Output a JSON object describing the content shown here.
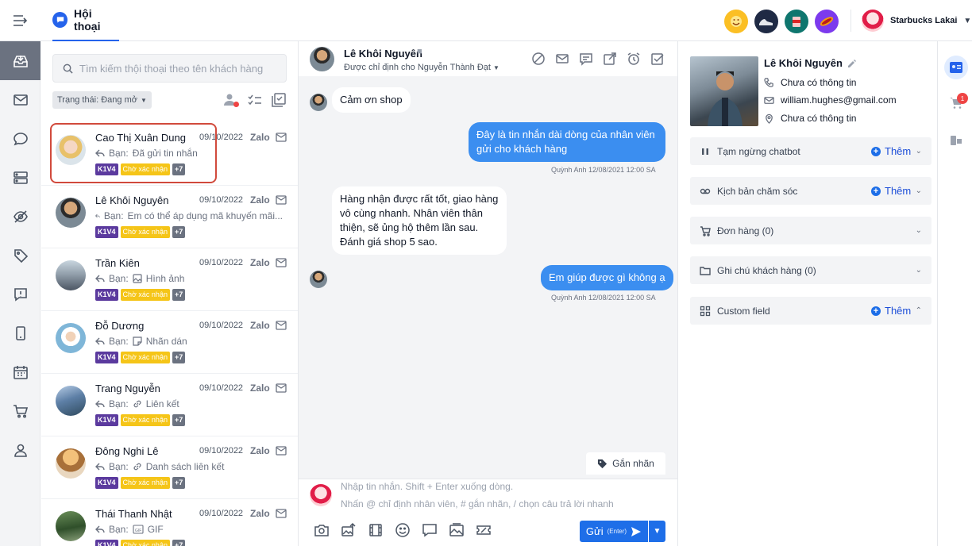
{
  "header": {
    "tab_title": "Hội thoại",
    "user_name": "Starbucks Lakai",
    "channels": [
      "emoji-cup-icon",
      "sneaker-icon",
      "coffee-cup-icon",
      "hotdog-icon"
    ]
  },
  "nav": {
    "items": [
      "inbox-icon",
      "mail-icon",
      "chat-bubble-icon",
      "server-icon",
      "eye-off-icon",
      "tag-icon",
      "feedback-icon",
      "mobile-icon",
      "calendar-icon",
      "cart-icon",
      "user-icon"
    ],
    "active": "inbox-icon"
  },
  "conv_list": {
    "search_placeholder": "Tìm kiếm thội thoại theo tên khách hàng",
    "status_filter": "Trạng thái: Đang mở",
    "tags": {
      "t1": "K1V4",
      "t2": "Chờ xác nhận",
      "t3": "+7"
    },
    "items": [
      {
        "name": "Cao Thị Xuân Dung",
        "date": "09/10/2022",
        "channel": "Zalo",
        "prefix": "Bạn:",
        "last": "Đã gửi tin nhắn",
        "attach_icon": ""
      },
      {
        "name": "Lê Khôi Nguyên",
        "date": "09/10/2022",
        "channel": "Zalo",
        "prefix": "Bạn:",
        "last": "Em có thể áp dụng mã khuyến mãi...",
        "attach_icon": ""
      },
      {
        "name": "Trần Kiên",
        "date": "09/10/2022",
        "channel": "Zalo",
        "prefix": "Bạn:",
        "last": "Hình ảnh",
        "attach_icon": "image-icon"
      },
      {
        "name": "Đỗ Dương",
        "date": "09/10/2022",
        "channel": "Zalo",
        "prefix": "Bạn:",
        "last": "Nhãn dán",
        "attach_icon": "sticker-icon"
      },
      {
        "name": "Trang Nguyễn",
        "date": "09/10/2022",
        "channel": "Zalo",
        "prefix": "Bạn:",
        "last": "Liên kết",
        "attach_icon": "link-icon"
      },
      {
        "name": "Đông Nghi Lê",
        "date": "09/10/2022",
        "channel": "Zalo",
        "prefix": "Bạn:",
        "last": "Danh sách liên kết",
        "attach_icon": "link-icon"
      },
      {
        "name": "Thái Thanh Nhật",
        "date": "09/10/2022",
        "channel": "Zalo",
        "prefix": "Bạn:",
        "last": "GIF",
        "attach_icon": "gif-icon"
      }
    ]
  },
  "chat": {
    "contact_name": "Lê Khôi Nguyên",
    "assigned": "Được chỉ định cho Nguyễn Thành Đạt",
    "messages": [
      {
        "dir": "in",
        "text": "Cảm ơn shop"
      },
      {
        "dir": "out",
        "text": "Đây là tin nhắn dài dòng của nhân viên gửi cho khách hàng",
        "meta": "Quỳnh Anh 12/08/2021 12:00 SA"
      },
      {
        "dir": "in",
        "text": "Hàng nhận được rất tốt, giao hàng vô cùng nhanh. Nhân viên thân thiện, sẽ ủng hộ thêm lần sau. Đánh giá shop 5 sao."
      },
      {
        "dir": "out",
        "text": "Em giúp được gì không ạ",
        "meta": "Quỳnh Anh 12/08/2021 12:00 SA"
      }
    ],
    "label_button": "Gắn nhãn",
    "composer_placeholder_1": "Nhập tin nhắn. Shift + Enter xuống dòng.",
    "composer_placeholder_2": "Nhấn @ chỉ định nhân viên, # gắn nhãn, / chọn câu trả lời nhanh",
    "send_label": "Gửi",
    "send_hint": "(Enter)"
  },
  "profile": {
    "name": "Lê Khôi Nguyên",
    "phone": "Chưa có thông tin",
    "email": "william.hughes@gmail.com",
    "address": "Chưa có thông tin",
    "sections": [
      {
        "label": "Tạm ngừng chatbot",
        "add": "Thêm",
        "chevron": "down"
      },
      {
        "label": "Kịch bản chăm sóc",
        "add": "Thêm",
        "chevron": "down"
      },
      {
        "label": "Đơn hàng (0)",
        "add": "",
        "chevron": "down"
      },
      {
        "label": "Ghi chú khách hàng (0)",
        "add": "",
        "chevron": "down"
      },
      {
        "label": "Custom field",
        "add": "Thêm",
        "chevron": "up"
      }
    ]
  },
  "rail": {
    "cart_badge": "1"
  }
}
